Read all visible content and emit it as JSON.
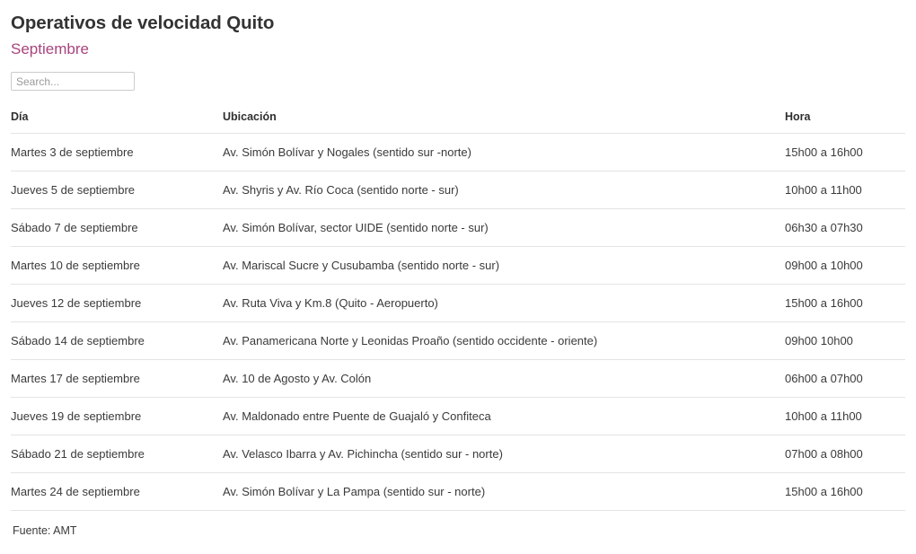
{
  "header": {
    "title": "Operativos de velocidad Quito",
    "subtitle": "Septiembre",
    "subtitle_color": "#a8447e",
    "title_color": "#333333"
  },
  "search": {
    "placeholder": "Search...",
    "value": ""
  },
  "table": {
    "columns": [
      {
        "key": "dia",
        "label": "Día"
      },
      {
        "key": "ubicacion",
        "label": "Ubicación"
      },
      {
        "key": "hora",
        "label": "Hora"
      }
    ],
    "rows": [
      {
        "dia": "Martes 3 de septiembre",
        "ubicacion": "Av. Simón Bolívar y Nogales (sentido sur -norte)",
        "hora": "15h00 a 16h00"
      },
      {
        "dia": "Jueves 5 de septiembre",
        "ubicacion": "Av. Shyris y Av. Río Coca (sentido norte - sur)",
        "hora": "10h00 a 11h00"
      },
      {
        "dia": "Sábado 7 de septiembre",
        "ubicacion": "Av. Simón Bolívar, sector UIDE (sentido norte - sur)",
        "hora": "06h30 a 07h30"
      },
      {
        "dia": "Martes 10 de septiembre",
        "ubicacion": "Av. Mariscal Sucre y Cusubamba (sentido norte - sur)",
        "hora": "09h00 a 10h00"
      },
      {
        "dia": "Jueves 12 de septiembre",
        "ubicacion": "Av. Ruta Viva y Km.8 (Quito - Aeropuerto)",
        "hora": "15h00 a 16h00"
      },
      {
        "dia": "Sábado 14 de septiembre",
        "ubicacion": "Av. Panamericana Norte y Leonidas Proaño (sentido occidente - oriente)",
        "hora": "09h00 10h00"
      },
      {
        "dia": "Martes 17 de septiembre",
        "ubicacion": "Av. 10 de Agosto y Av. Colón",
        "hora": "06h00 a 07h00"
      },
      {
        "dia": "Jueves 19 de septiembre",
        "ubicacion": "Av. Maldonado entre Puente de Guajaló y Confiteca",
        "hora": "10h00 a 11h00"
      },
      {
        "dia": "Sábado 21 de septiembre",
        "ubicacion": "Av. Velasco Ibarra y Av. Pichincha (sentido sur - norte)",
        "hora": "07h00 a 08h00"
      },
      {
        "dia": "Martes 24 de septiembre",
        "ubicacion": "Av. Simón Bolívar y La Pampa (sentido sur - norte)",
        "hora": "15h00 a 16h00"
      }
    ]
  },
  "footer": {
    "source": "Fuente: AMT"
  }
}
